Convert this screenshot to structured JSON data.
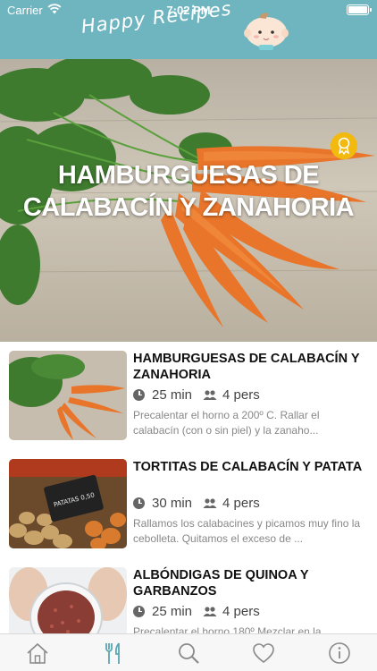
{
  "status_bar": {
    "carrier": "Carrier",
    "time": "7:02 PM",
    "wifi_icon": "wifi-icon",
    "battery_icon": "battery-icon"
  },
  "header": {
    "brand": "Happy Recipes",
    "mascot_icon": "baby-face-icon",
    "color": "#6fb5c0"
  },
  "hero": {
    "title": "HAMBURGUESAS DE CALABACÍN Y ZANAHORIA",
    "badge_icon": "award-ribbon-icon",
    "badge_color": "#f2b90f"
  },
  "recipes": [
    {
      "title": "HAMBURGUESAS DE CALABACÍN Y ZANAHORIA",
      "time": "25 min",
      "servings": "4 pers",
      "description": "Precalentar el horno a 200º C. Rallar el calabacín (con o sin piel) y la zanaho..."
    },
    {
      "title": "TORTITAS DE CALABACÍN Y PATATA",
      "time": "30 min",
      "servings": "4 pers",
      "description": "Rallamos los calabacines y picamos muy fino la cebolleta. Quitamos el exceso de ...",
      "thumb_sign": "PATATAS 0,50"
    },
    {
      "title": "ALBÓNDIGAS DE QUINOA Y GARBANZOS",
      "time": "25 min",
      "servings": "4 pers",
      "description": "Precalentar el horno 180º Mezclar en la..."
    }
  ],
  "tabbar": {
    "items": [
      {
        "icon": "home-icon",
        "active": false
      },
      {
        "icon": "fork-knife-icon",
        "active": true
      },
      {
        "icon": "search-icon",
        "active": false
      },
      {
        "icon": "heart-icon",
        "active": false
      },
      {
        "icon": "info-icon",
        "active": false
      }
    ],
    "active_color": "#5aa6b3",
    "inactive_color": "#8a8a8a"
  }
}
